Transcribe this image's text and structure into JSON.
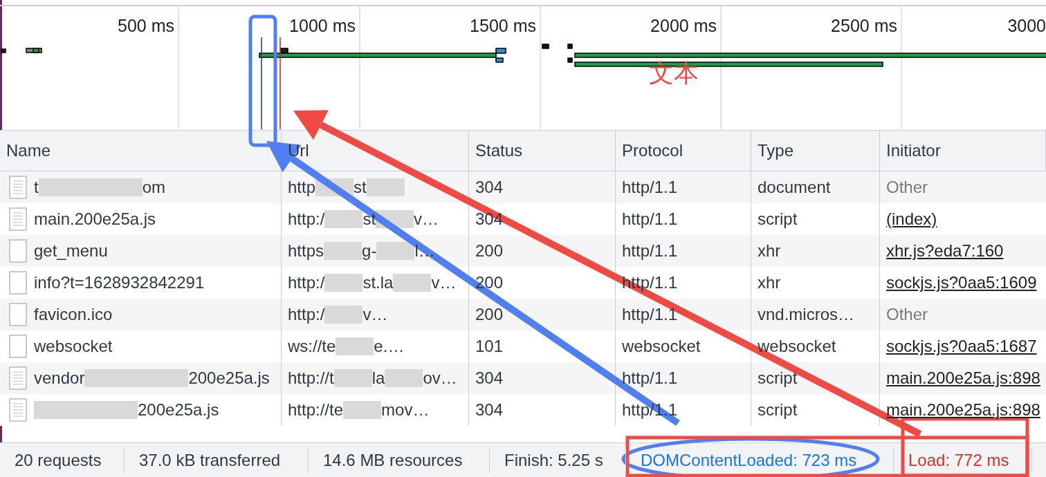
{
  "timeline": {
    "ticks": [
      "500 ms",
      "1000 ms",
      "1500 ms",
      "2000 ms",
      "2500 ms",
      "3000"
    ]
  },
  "table": {
    "columns": [
      "Name",
      "Url",
      "Status",
      "Protocol",
      "Type",
      "Initiator"
    ],
    "rows": [
      {
        "kind": "file",
        "name": [
          {
            "kind": "text",
            "text": "t"
          },
          {
            "kind": "blur"
          },
          {
            "kind": "text",
            "text": "om"
          }
        ],
        "url": [
          {
            "kind": "text",
            "text": "http"
          },
          {
            "kind": "blur"
          },
          {
            "kind": "text",
            "text": "st"
          },
          {
            "kind": "blur"
          }
        ],
        "status": "304",
        "protocol": "http/1.1",
        "type": "document",
        "initiator": {
          "kind": "plain",
          "text": "Other"
        }
      },
      {
        "kind": "file",
        "name": [
          {
            "kind": "text",
            "text": "main.200e25a.js"
          }
        ],
        "url": [
          {
            "kind": "text",
            "text": "http:/"
          },
          {
            "kind": "blur"
          },
          {
            "kind": "text",
            "text": "st"
          },
          {
            "kind": "blur"
          },
          {
            "kind": "text",
            "text": "v…"
          }
        ],
        "status": "304",
        "protocol": "http/1.1",
        "type": "script",
        "initiator": {
          "kind": "link",
          "text": "(index)"
        }
      },
      {
        "kind": "request",
        "name": [
          {
            "kind": "text",
            "text": "get_menu"
          }
        ],
        "url": [
          {
            "kind": "text",
            "text": "https"
          },
          {
            "kind": "blur"
          },
          {
            "kind": "text",
            "text": "g-"
          },
          {
            "kind": "blur"
          },
          {
            "kind": "text",
            "text": "l…"
          }
        ],
        "status": "200",
        "protocol": "http/1.1",
        "type": "xhr",
        "initiator": {
          "kind": "link",
          "text": "xhr.js?eda7:160"
        }
      },
      {
        "kind": "request",
        "name": [
          {
            "kind": "text",
            "text": "info?t=1628932842291"
          }
        ],
        "url": [
          {
            "kind": "text",
            "text": "http:/"
          },
          {
            "kind": "blur"
          },
          {
            "kind": "text",
            "text": "st.la"
          },
          {
            "kind": "blur"
          },
          {
            "kind": "text",
            "text": "v…"
          }
        ],
        "status": "200",
        "protocol": "http/1.1",
        "type": "xhr",
        "initiator": {
          "kind": "link",
          "text": "sockjs.js?0aa5:1609"
        }
      },
      {
        "kind": "request",
        "name": [
          {
            "kind": "text",
            "text": "favicon.ico"
          }
        ],
        "url": [
          {
            "kind": "text",
            "text": "http:/"
          },
          {
            "kind": "blur"
          },
          {
            "kind": "text",
            "text": "v…"
          }
        ],
        "status": "200",
        "protocol": "http/1.1",
        "type": "vnd.micros…",
        "initiator": {
          "kind": "plain",
          "text": "Other"
        }
      },
      {
        "kind": "request",
        "name": [
          {
            "kind": "text",
            "text": "websocket"
          }
        ],
        "url": [
          {
            "kind": "text",
            "text": "ws://te"
          },
          {
            "kind": "blur"
          },
          {
            "kind": "text",
            "text": "e.…"
          }
        ],
        "status": "101",
        "protocol": "websocket",
        "type": "websocket",
        "initiator": {
          "kind": "link",
          "text": "sockjs.js?0aa5:1687"
        }
      },
      {
        "kind": "file",
        "name": [
          {
            "kind": "text",
            "text": "vendor"
          },
          {
            "kind": "blur"
          },
          {
            "kind": "text",
            "text": "200e25a.js"
          }
        ],
        "url": [
          {
            "kind": "text",
            "text": "http://t"
          },
          {
            "kind": "blur"
          },
          {
            "kind": "text",
            "text": "la"
          },
          {
            "kind": "blur"
          },
          {
            "kind": "text",
            "text": "ov…"
          }
        ],
        "status": "304",
        "protocol": "http/1.1",
        "type": "script",
        "initiator": {
          "kind": "link",
          "text": "main.200e25a.js:898"
        }
      },
      {
        "kind": "file",
        "name": [
          {
            "kind": "blur"
          },
          {
            "kind": "text",
            "text": "200e25a.js"
          }
        ],
        "url": [
          {
            "kind": "text",
            "text": "http://te"
          },
          {
            "kind": "blur"
          },
          {
            "kind": "text",
            "text": "mov…"
          }
        ],
        "status": "304",
        "protocol": "http/1.1",
        "type": "script",
        "initiator": {
          "kind": "link",
          "text": "main.200e25a.js:898"
        }
      }
    ]
  },
  "status_bar": [
    {
      "text": "20 requests",
      "color": "#303942"
    },
    {
      "text": "37.0 kB transferred",
      "color": "#303942"
    },
    {
      "text": "14.6 MB resources",
      "color": "#303942"
    },
    {
      "text": "Finish: 5.25 s",
      "color": "#303942"
    },
    {
      "text": "DOMContentLoaded: 723 ms",
      "color": "#1a73e8"
    },
    {
      "text": "Load: 772 ms",
      "color": "#d93025"
    }
  ],
  "annotations": [
    {
      "kind": "rounded_box",
      "color": "#4f7ff0"
    },
    {
      "kind": "arrow",
      "color": "#4f7ff0"
    },
    {
      "kind": "ellipse",
      "color": "#4f7ff0"
    },
    {
      "kind": "arrow",
      "color": "#ef4a43"
    },
    {
      "kind": "box",
      "color": "#ef4a43"
    },
    {
      "kind": "box",
      "color": "#ef4a43"
    },
    {
      "kind": "text",
      "text": "文本",
      "color": "#ef4a43"
    }
  ]
}
